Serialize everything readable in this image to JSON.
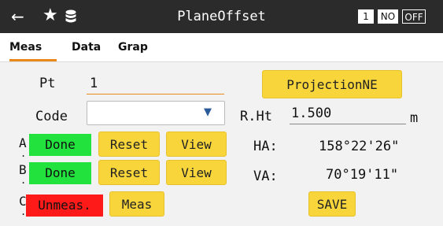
{
  "header": {
    "title": "PlaneOffset",
    "back_icon": "arrow-left-icon",
    "star_icon": "star-icon",
    "database_icon": "database-icon",
    "indicator_1": "1",
    "indicator_2": "NO",
    "indicator_3": "OFF"
  },
  "tabs": [
    {
      "label": "Meas",
      "active": true
    },
    {
      "label": "Data",
      "active": false
    },
    {
      "label": "Grap",
      "active": false
    }
  ],
  "form": {
    "pt_label": "Pt",
    "pt_value": "1",
    "code_label": "Code",
    "code_value": "",
    "projection_button": "ProjectionNE",
    "rht_label": "R.Ht",
    "rht_value": "1.500",
    "rht_unit": "m",
    "ha_label": "HA:",
    "ha_value": "158°22'26\"",
    "va_label": "VA:",
    "va_value": "70°19'11\"",
    "save_button": "SAVE"
  },
  "points": [
    {
      "letter": "A",
      "status": "Done",
      "reset": "Reset",
      "view": "View",
      "status_color": "#22e33d"
    },
    {
      "letter": "B",
      "status": "Done",
      "reset": "Reset",
      "view": "View",
      "status_color": "#22e33d"
    },
    {
      "letter": "C",
      "status": "Unmeas.",
      "meas": "Meas",
      "status_color": "#ff1a1a"
    }
  ]
}
